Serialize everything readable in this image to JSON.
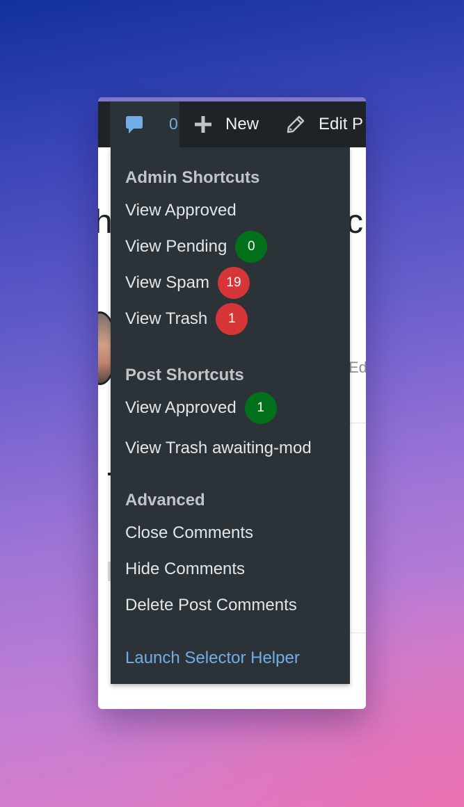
{
  "colors": {
    "adminbar_bg": "#1d2327",
    "menu_bg": "#2c3338",
    "link_blue": "#72aee6",
    "badge_green": "#00701a",
    "badge_red": "#d63638"
  },
  "admin_bar": {
    "comments": {
      "icon": "comment-bubble-icon",
      "count": "0"
    },
    "new": {
      "icon": "plus-icon",
      "label": "New"
    },
    "edit": {
      "icon": "pencil-icon",
      "label": "Edit P"
    }
  },
  "background_text": {
    "heading_left": "h",
    "heading_right": "c",
    "edit_fragment": "Ed"
  },
  "menu": {
    "admin_shortcuts": {
      "heading": "Admin Shortcuts",
      "items": [
        {
          "label": "View Approved"
        },
        {
          "label": "View Pending",
          "badge": "0",
          "badge_color": "green"
        },
        {
          "label": "View Spam",
          "badge": "19",
          "badge_color": "red"
        },
        {
          "label": "View Trash",
          "badge": "1",
          "badge_color": "red"
        }
      ]
    },
    "post_shortcuts": {
      "heading": "Post Shortcuts",
      "items": [
        {
          "label": "View Approved",
          "badge": "1",
          "badge_color": "green"
        },
        {
          "label": "View Trash awaiting-mod"
        }
      ]
    },
    "advanced": {
      "heading": "Advanced",
      "items": [
        {
          "label": "Close Comments"
        },
        {
          "label": "Hide Comments"
        },
        {
          "label": "Delete Post Comments"
        }
      ]
    },
    "footer_link": "Launch Selector Helper"
  }
}
